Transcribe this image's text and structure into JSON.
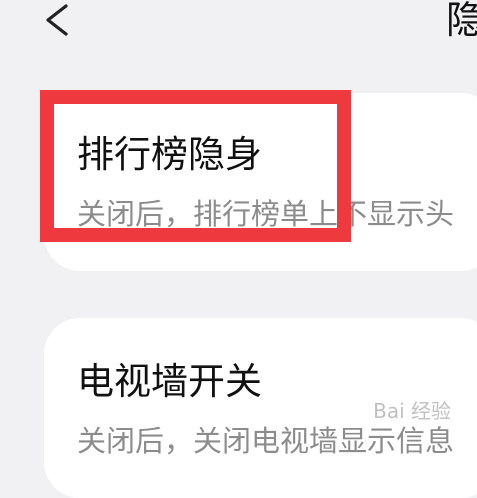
{
  "header": {
    "title": "隐",
    "back_icon": "chevron-left-icon"
  },
  "settings": [
    {
      "title": "排行榜隐身",
      "subtitle": "关闭后，排行榜单上不显示头"
    },
    {
      "title": "电视墙开关",
      "subtitle": "关闭后，关闭电视墙显示信息"
    }
  ],
  "annotation": {
    "color": "#ee3a3f"
  },
  "watermark": "Bai 经验"
}
